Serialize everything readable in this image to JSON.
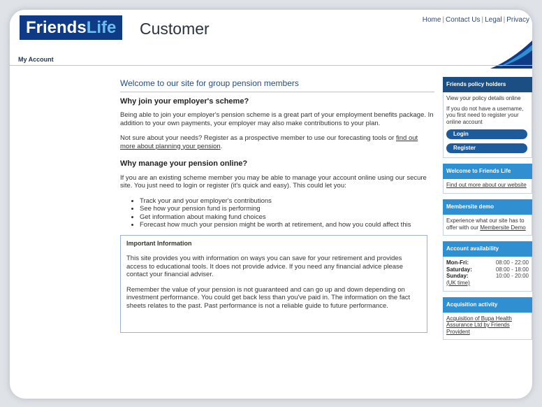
{
  "header": {
    "logo_friends": "Friends",
    "logo_life": "Life",
    "subtitle": "Customer",
    "links": [
      "Home",
      "Contact Us",
      "Legal",
      "Privacy"
    ],
    "nav_label": "My Account"
  },
  "main": {
    "title": "Welcome to our site for group pension members",
    "section1": {
      "heading": "Why join your employer's scheme?",
      "p1": "Being able to join your employer's pension scheme is a great part of your employment benefits package. In addition to your own payments, your employer may also make contributions to your plan.",
      "p2_prefix": "Not sure about your needs? Register as a prospective member to use our forecasting tools or ",
      "p2_link": "find out more about planning your pension",
      "p2_suffix": "."
    },
    "section2": {
      "heading": "Why manage your pension online?",
      "p1": "If you are an existing scheme member you may be able to manage your account online using our secure site. You just need to login or register (it's quick and easy). This could let you:",
      "bullets": [
        "Track your and your employer's contributions",
        "See how your pension fund is performing",
        "Get information about making fund choices",
        "Forecast how much your pension might be worth at retirement, and how you could affect this"
      ]
    },
    "important": {
      "title": "Important Information",
      "p1": "This site provides you with information on ways you can save for your retirement and provides access to educational tools. It does not provide advice. If you need any financial advice please contact your financial adviser.",
      "p2": "Remember the value of your pension is not guaranteed and can go up and down depending on investment performance. You could get back less than you've paid in. The information on the fact sheets relates to the past. Past performance is not a reliable guide to future performance."
    }
  },
  "sidebar": {
    "policy": {
      "title": "Friends policy holders",
      "text1": "View your policy details online",
      "text2": "If you do not have a username, you first need to register your online account",
      "login": "Login",
      "register": "Register"
    },
    "welcome": {
      "title": "Welcome to Friends Life",
      "link": "Find out more about our website"
    },
    "demo": {
      "title": "Membersite demo",
      "text": "Experience what our site has to offer with our ",
      "link": "Membersite Demo"
    },
    "availability": {
      "title": "Account availability",
      "rows": [
        {
          "day": "Mon-Fri:",
          "time": "08:00 - 22:00"
        },
        {
          "day": "Saturday:",
          "time": "08:00 - 18:00"
        },
        {
          "day": "Sunday:",
          "time": "10:00 - 20:00"
        }
      ],
      "note": "(UK time)"
    },
    "acquisition": {
      "title": "Acquisition activity",
      "link": "Acquisition of Bupa Health Assurance Ltd by Friends Provident"
    }
  },
  "colors": {
    "brand_navy": "#0f3b86",
    "brand_light_blue": "#6cbef0",
    "panel_header": "#1b4f84",
    "panel_header_light": "#2f8fd1",
    "pill_button": "#1e5b9d",
    "title_blue": "#234e7d"
  }
}
